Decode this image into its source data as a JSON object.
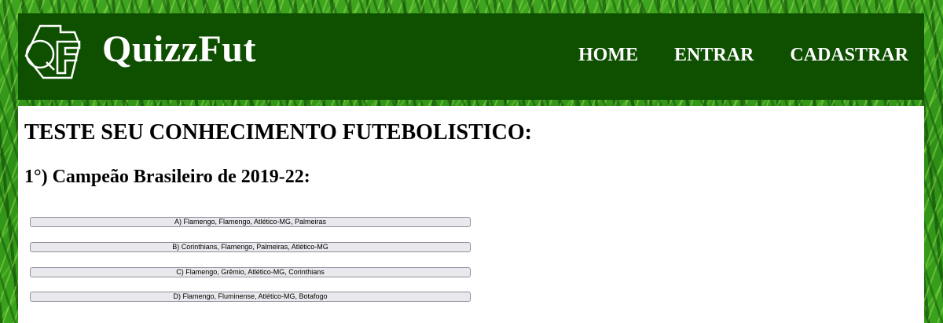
{
  "brand": {
    "name": "QuizzFut",
    "logo_text": "QF"
  },
  "nav": {
    "items": [
      {
        "label": "HOME"
      },
      {
        "label": "ENTRAR"
      },
      {
        "label": "CADASTRAR"
      }
    ]
  },
  "main": {
    "title": "TESTE SEU CONHECIMENTO FUTEBOLISTICO:",
    "question": {
      "text": "1°) Campeão Brasileiro de 2019-22:",
      "options": [
        "A) Flamengo, Flamengo, Atlético-MG, Palmeiras",
        "B) Corinthians, Flamengo, Palmeiras, Atlético-MG",
        "C) Flamengo, Grêmio, Atlético-MG, Corinthians",
        "D) Flamengo, Fluminense, Atlético-MG, Botafogo"
      ]
    }
  },
  "colors": {
    "header_bg": "#0e4f00",
    "background_texture": "grass-green",
    "button_bg": "#e9e9ed"
  },
  "icons": {
    "logo": "qf-shield-logo-icon"
  }
}
